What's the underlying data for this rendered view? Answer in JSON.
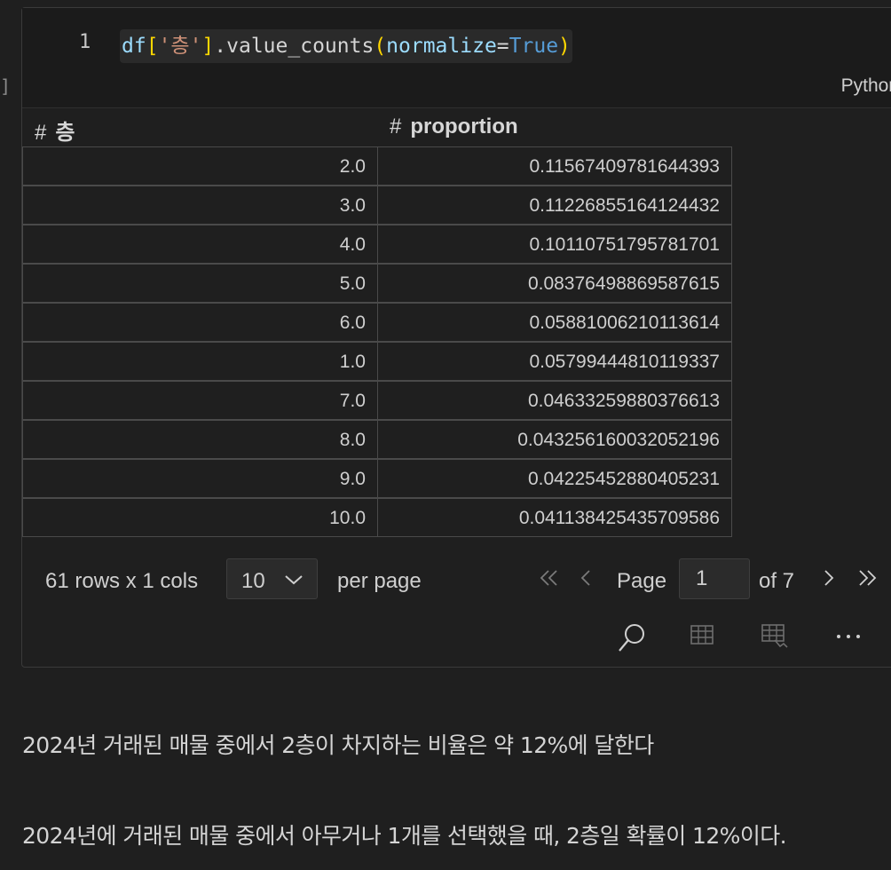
{
  "cell": {
    "line_number": "1",
    "code_tokens": {
      "var": "df",
      "open_bracket": "[",
      "string": "'층'",
      "close_bracket": "]",
      "dot": ".",
      "method": "value_counts",
      "open_paren": "(",
      "param": "normalize",
      "equals": "=",
      "value": "True",
      "close_paren": ")"
    },
    "language": "Python"
  },
  "table": {
    "columns": [
      "층",
      "proportion"
    ],
    "column_type_marker": "#",
    "rows": [
      [
        "2.0",
        "0.11567409781644393"
      ],
      [
        "3.0",
        "0.11226855164124432"
      ],
      [
        "4.0",
        "0.10110751795781701"
      ],
      [
        "5.0",
        "0.08376498869587615"
      ],
      [
        "6.0",
        "0.05881006210113614"
      ],
      [
        "1.0",
        "0.05799444810119337"
      ],
      [
        "7.0",
        "0.04633259880376613"
      ],
      [
        "8.0",
        "0.043256160032052196"
      ],
      [
        "9.0",
        "0.04225452880405231"
      ],
      [
        "10.0",
        "0.041138425435709586"
      ]
    ]
  },
  "pager": {
    "summary": "61 rows x 1 cols",
    "page_size": "10",
    "per_page_label": "per page",
    "page_label": "Page",
    "current_page": "1",
    "of_label": "of 7"
  },
  "text": {
    "para1": "2024년 거래된 매물 중에서 2층이 차지하는 비율은 약 12%에 달한다",
    "para2": "2024년에 거래된 매물 중에서 아무거나 1개를 선택했을 때, 2층일 확률이 12%이다."
  },
  "colors": {
    "background": "#1f1f1f",
    "code_background": "#1b1b1b",
    "border": "#4a4a4a",
    "keyword": "#569cd6",
    "string": "#ce9178",
    "variable": "#9cdcfe",
    "bracket": "#ffd700",
    "function": "#dcdcaa"
  },
  "icons": {
    "first_page": "double-chevron-left-icon",
    "prev_page": "chevron-left-icon",
    "next_page": "chevron-right-icon",
    "last_page": "double-chevron-right-icon",
    "dropdown": "chevron-down-icon",
    "search": "search-icon",
    "table_view": "table-icon",
    "filter_table": "table-filter-icon",
    "more": "more-icon"
  }
}
